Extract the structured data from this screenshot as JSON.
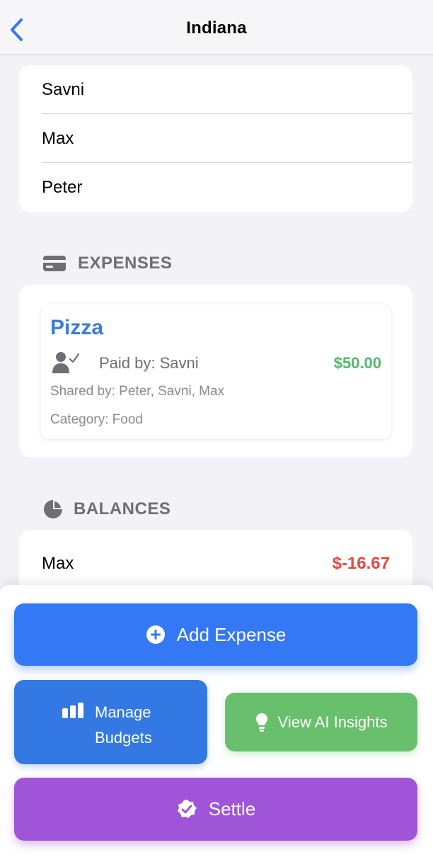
{
  "nav": {
    "title": "Indiana",
    "back_icon": "chevron-left-icon"
  },
  "members": [
    "Savni",
    "Max",
    "Peter"
  ],
  "expenses": {
    "header": "EXPENSES",
    "icon": "credit-card-icon",
    "items": [
      {
        "title": "Pizza",
        "paid_by": "Paid by: Savni",
        "amount": "$50.00",
        "shared_by": "Shared by: Peter, Savni, Max",
        "category": "Category: Food"
      }
    ]
  },
  "balances": {
    "header": "BALANCES",
    "icon": "pie-chart-icon",
    "items": [
      {
        "name": "Max",
        "amount": "$-16.67"
      }
    ]
  },
  "actions": {
    "add_expense": "Add Expense",
    "manage_budgets_line1": "Manage",
    "manage_budgets_line2": "Budgets",
    "view_ai_insights": "View AI Insights",
    "settle": "Settle"
  },
  "colors": {
    "accent_blue": "#3478f6",
    "positive_green": "#52b86a",
    "negative_red": "#e2493e",
    "settle_purple": "#a055d8",
    "insights_green": "#68bf6c"
  }
}
